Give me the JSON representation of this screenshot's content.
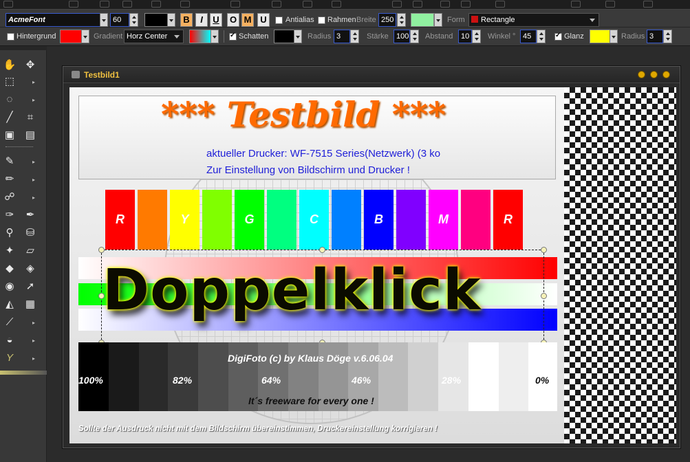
{
  "toolbar1": {
    "font_name": "AcmeFont",
    "font_size": "60",
    "bold_label": "B",
    "italic_label": "I",
    "underline_label": "U",
    "outline_label": "O",
    "m_label": "M",
    "u2_label": "U",
    "antialias_label": "Antialias",
    "frame_label": "Rahmen",
    "width_label": "Breite",
    "width_value": "250",
    "form_label": "Form",
    "form_value": "Rectangle"
  },
  "toolbar2": {
    "background_label": "Hintergrund",
    "gradient_label": "Gradient",
    "gradient_value": "Horz Center",
    "shadow_label": "Schatten",
    "radius_label": "Radius",
    "radius_value": "3",
    "strength_label": "Stärke",
    "strength_value": "100",
    "distance_label": "Abstand",
    "distance_value": "10",
    "angle_label": "Winkel °",
    "angle_value": "45",
    "gloss_label": "Glanz",
    "radius2_label": "Radius",
    "radius2_value": "3"
  },
  "window": {
    "title": "Testbild1"
  },
  "image": {
    "headline": "*** Testbild ***",
    "printer_line": "aktueller Drucker: WF-7515 Series(Netzwerk) (3 ko",
    "settings_line": "Zur Einstellung von Bildschirm und Drucker !",
    "color_bar_labels": [
      "R",
      "",
      "Y",
      "",
      "G",
      "",
      "C",
      "",
      "B",
      "",
      "M",
      "",
      "R"
    ],
    "overlay_text": "Doppelklick",
    "credit": "DigiFoto (c) by Klaus Döge v.6.06.04",
    "percentages": [
      "100%",
      "82%",
      "64%",
      "46%",
      "28%",
      "0%"
    ],
    "freeware": "It´s freeware for every one !",
    "footer": "Sollte der Ausdruck nicht mit dem Bildschirm übereinstimmen, Druckereinstellung korrigieren !"
  },
  "colors": {
    "color_bars": [
      "#ff0000",
      "#ff7a00",
      "#ffff00",
      "#80ff00",
      "#00ff00",
      "#00ff80",
      "#00ffff",
      "#0080ff",
      "#0000ff",
      "#8000ff",
      "#ff00ff",
      "#ff0080",
      "#ff0000"
    ],
    "gray_steps": [
      "#000000",
      "#1a1a1a",
      "#2a2a2a",
      "#3a3a3a",
      "#4d4d4d",
      "#5e5e5e",
      "#707070",
      "#828282",
      "#959595",
      "#a8a8a8",
      "#bcbcbc",
      "#d0d0d0",
      "#e6e6e6",
      "#ffffff"
    ],
    "glow_color": "#ffff00",
    "form_swatch": "#cc1111",
    "text_color_swatch": "#000000",
    "font_color_swatch": "#90f0a0",
    "background_swatch": "#ff0000",
    "shadow_swatch": "#000000",
    "gradient_swatch_start": "#ff0000",
    "gradient_swatch_end": "#00ffff"
  }
}
